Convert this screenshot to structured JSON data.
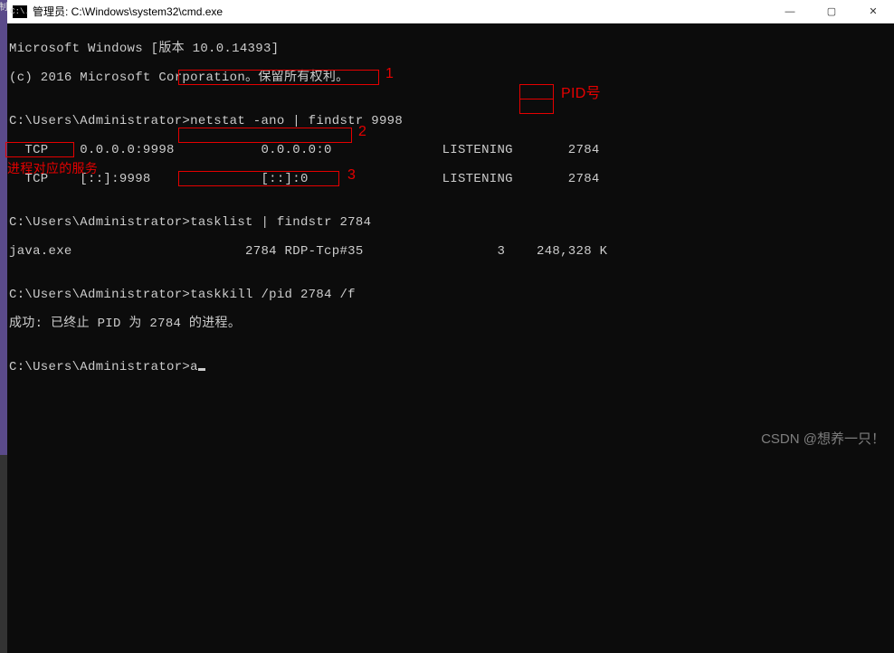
{
  "left_strip": "制",
  "titlebar": {
    "icon_glyph": "C:\\.",
    "title": "管理员: C:\\Windows\\system32\\cmd.exe",
    "min": "—",
    "max": "▢",
    "close": "✕"
  },
  "lines": {
    "l0": "Microsoft Windows [版本 10.0.14393]",
    "l1": "(c) 2016 Microsoft Corporation。保留所有权利。",
    "l2": "",
    "l3a": "C:\\Users\\Administrator>",
    "l3b": "netstat -ano | findstr 9998",
    "l4": "  TCP    0.0.0.0:9998           0.0.0.0:0              LISTENING       2784",
    "l5": "  TCP    [::]:9998              [::]:0                 LISTENING       2784",
    "l6": "",
    "l7a": "C:\\Users\\Administrator>",
    "l7b": "tasklist | findstr 2784",
    "l8": "java.exe                      2784 RDP-Tcp#35                 3    248,328 K",
    "l9": "",
    "l10a": "C:\\Users\\Administrator>",
    "l10b": "taskkill /pid 2784 /f",
    "l11": "成功: 已终止 PID 为 2784 的进程。",
    "l12": "",
    "l13a": "C:\\Users\\Administrator>",
    "l13b": "a"
  },
  "annotations": {
    "a1": "1",
    "a2": "2",
    "a3": "3",
    "pid": "PID号",
    "svc": "进程对应的服务"
  },
  "watermark": "CSDN @想养一只！"
}
